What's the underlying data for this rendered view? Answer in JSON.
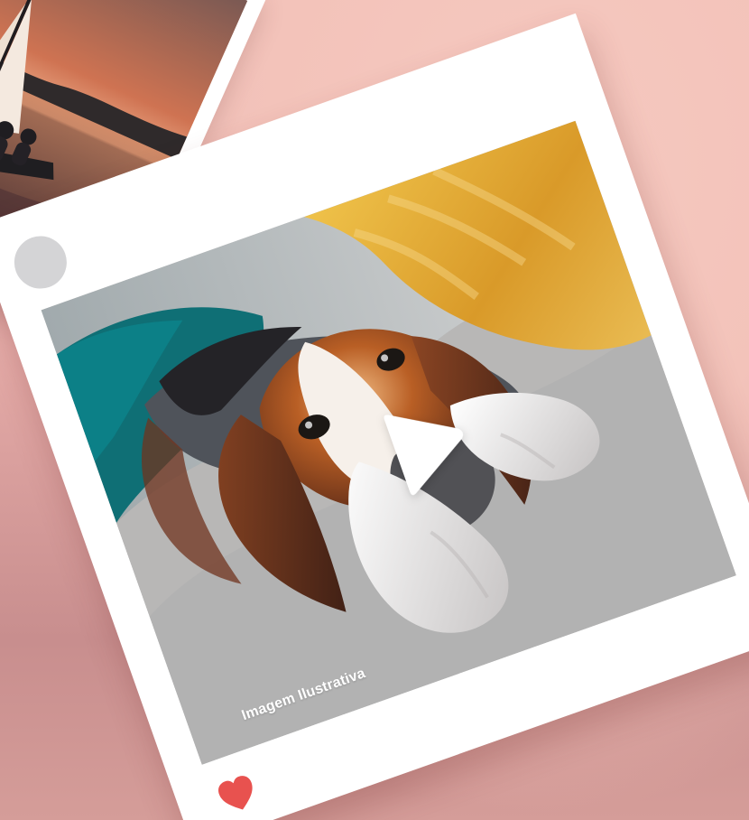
{
  "scene": {
    "background_colors": [
      "#f2c4bd",
      "#e3a9a6",
      "#c88e8e"
    ],
    "back_card": {
      "photo_subject": "sunset sailboat on lake"
    },
    "main_card": {
      "avatar": {
        "color": "#d4d4d6"
      },
      "photo": {
        "subject": "beagle lying on sofa",
        "caption": "Imagem Ilustrativa"
      },
      "play_button": {
        "icon": "play-icon"
      },
      "like_button": {
        "icon": "heart-icon",
        "color": "#e8524f"
      }
    }
  }
}
